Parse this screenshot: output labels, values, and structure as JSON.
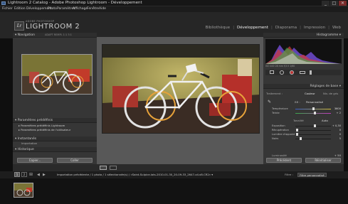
{
  "window": {
    "title": "Lightroom 2 Catalog - Adobe Photoshop Lightroom - Développement",
    "minimize": "_",
    "maximize": "□",
    "close": "✕"
  },
  "menu": [
    "Fichier",
    "Edition",
    "Développement",
    "Photo",
    "Paramètres",
    "Affichage",
    "Fenêtre",
    "Aide"
  ],
  "identity": {
    "logo_letters": "Lr",
    "brand_small": "ADOBE PHOTOSHOP",
    "brand_big": "LIGHTROOM 2"
  },
  "modules": {
    "items": [
      "Bibliothèque",
      "Développement",
      "Diaporama",
      "Impression",
      "Web"
    ],
    "separator": "|",
    "active_index": 1
  },
  "left_panel": {
    "navigator": {
      "title": "Navigation",
      "zoom_options": "ADAPT  REMPL  1:1  3:1"
    },
    "presets": {
      "title": "Paramètres prédéfinis",
      "items": [
        "Paramètres prédéfinis Lightroom",
        "Paramètres prédéfinis de l'utilisateur"
      ]
    },
    "snapshots": {
      "title": "Instantanés"
    },
    "import_label": "Importation",
    "history": {
      "title": "Historique"
    },
    "copy_button": "Copier...",
    "paste_button": "Coller"
  },
  "right_panel": {
    "histogram_title": "Histogramme",
    "histogram_readout": "ISO 400   28 mm   f/3.5   1/60",
    "basic": {
      "title": "Réglages de base",
      "treatment_label": "Traitement :",
      "treatment_color": "Couleur",
      "treatment_bw": "Niv. de gris",
      "wb_label": "BB :",
      "wb_value": "Personnalisé",
      "sliders": [
        {
          "label": "Température",
          "value": "3600",
          "position": 0.5
        },
        {
          "label": "Teinte",
          "value": "+ 2",
          "position": 0.55
        }
      ],
      "tone_label": "Tonalité",
      "tone_auto": "Auto",
      "tone_sliders": [
        {
          "label": "Exposition",
          "value": "+ 0,30",
          "position": 0.55
        },
        {
          "label": "Récupération",
          "value": "0",
          "position": 0.05
        },
        {
          "label": "Lumière d'appoint",
          "value": "0",
          "position": 0.05
        },
        {
          "label": "Noirs",
          "value": "5",
          "position": 0.15
        }
      ],
      "luminosity_label": "Luminosité",
      "luminosity_value": "+ 50"
    },
    "previous_button": "Précédent",
    "reset_button": "Réinitialiser"
  },
  "filmstrip_bar": {
    "text": "Importation précédente / 1 photo / 1 sélectionnée(s) / «Saint-Sulpice-lots-2010-01-30_20-09-33_2647-oil-vB.CR2» ▾",
    "filter_label": "Filtre :",
    "filter_value": "Filtre personnalisé",
    "pages": [
      "1",
      "2"
    ]
  },
  "colors": {
    "panel": "#363636",
    "background": "#0f0f0f",
    "center": "#585858",
    "active_module": "#f0f0f0"
  },
  "icons": [
    "back-icon",
    "forward-icon",
    "grid-icon",
    "loupe-icon",
    "compare-icon",
    "crop-icon",
    "spot-icon",
    "redeye-icon",
    "graduated-filter-icon",
    "brush-icon",
    "eyedropper-icon"
  ]
}
